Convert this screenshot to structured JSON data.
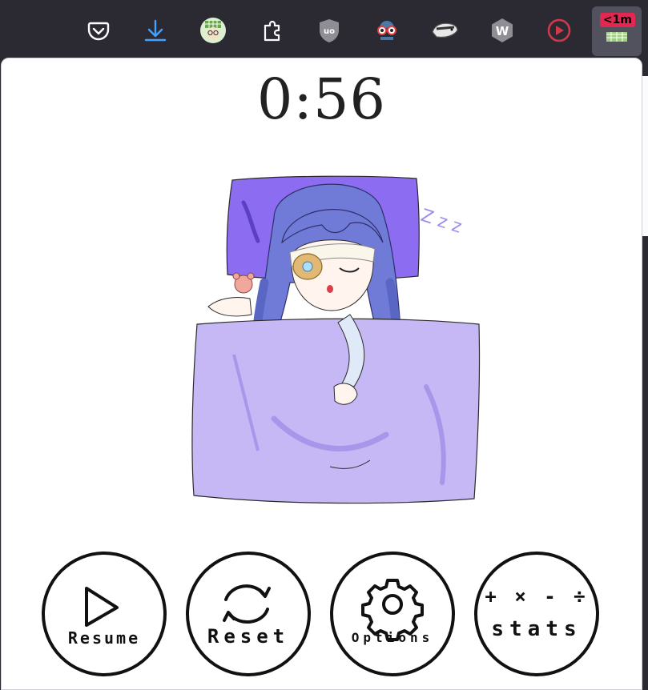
{
  "toolbar": {
    "icons": [
      "pocket-icon",
      "download-icon",
      "avatar-icon",
      "extensions-icon",
      "ublock-icon",
      "privacy-glasses-icon",
      "badger-icon",
      "w-extension-icon",
      "play-extension-icon",
      "timer-extension-icon"
    ],
    "badge_text": "<1m",
    "colors": {
      "background": "#2b2a33",
      "badge": "#e22850",
      "download": "#45a1ff"
    }
  },
  "timer": {
    "display": "0:56"
  },
  "illustration": {
    "subject": "sleeping-girl-in-bed",
    "zzz_text": "Z z z"
  },
  "buttons": {
    "resume": "Resume",
    "reset": "Reset",
    "options": "Options",
    "stats": "stats",
    "stats_symbols": "+ × - ÷"
  },
  "colors": {
    "ink": "#111111",
    "blanket": "#c6b8f4",
    "pillow": "#8c6cf0",
    "hair": "#6f7bd6"
  }
}
